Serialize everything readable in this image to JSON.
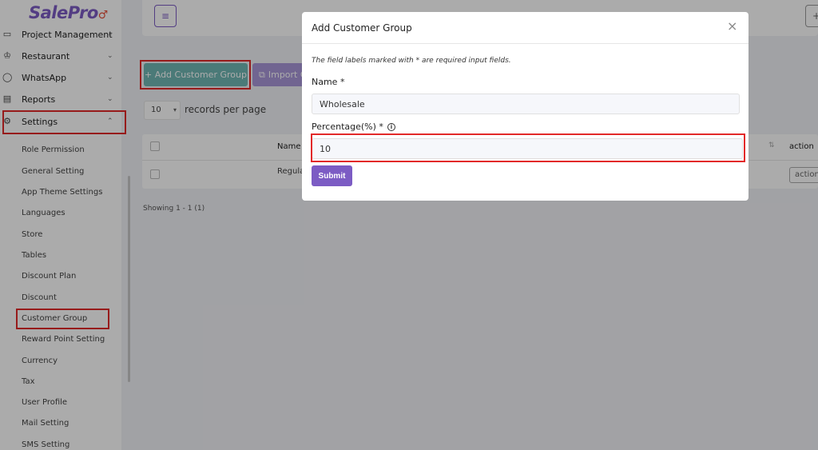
{
  "sidebar": {
    "logo": "SalePro",
    "menu": [
      {
        "label": "Project Management",
        "icon": "database-icon"
      },
      {
        "label": "Restaurant",
        "icon": "chef-hat-icon"
      },
      {
        "label": "WhatsApp",
        "icon": "whatsapp-icon"
      },
      {
        "label": "Reports",
        "icon": "report-icon"
      },
      {
        "label": "Settings",
        "icon": "gear-icon"
      }
    ],
    "settings_items": [
      "Role Permission",
      "General Setting",
      "App Theme Settings",
      "Languages",
      "Store",
      "Tables",
      "Discount Plan",
      "Discount",
      "Customer Group",
      "Reward Point Setting",
      "Currency",
      "Tax",
      "User Profile",
      "Mail Setting",
      "SMS Setting"
    ]
  },
  "toolbar": {
    "add_label": "+ Add Customer Group",
    "import_label": "Import Ca"
  },
  "table": {
    "per_page_value": "10",
    "per_page_label": "records per page",
    "columns": {
      "name": "Name",
      "action": "action"
    },
    "rows": [
      {
        "name": "Regula",
        "action": "action"
      }
    ],
    "showing": "Showing 1 - 1 (1)"
  },
  "modal": {
    "title": "Add Customer Group",
    "close": "×",
    "note": "The field labels marked with * are required input fields.",
    "name_label": "Name *",
    "name_value": "Wholesale",
    "percentage_label": "Percentage(%) *",
    "percentage_value": "10",
    "submit_label": "Submit"
  },
  "colors": {
    "accent": "#7c5cc4",
    "add_button": "#70b7b4",
    "highlight": "#e22929"
  }
}
